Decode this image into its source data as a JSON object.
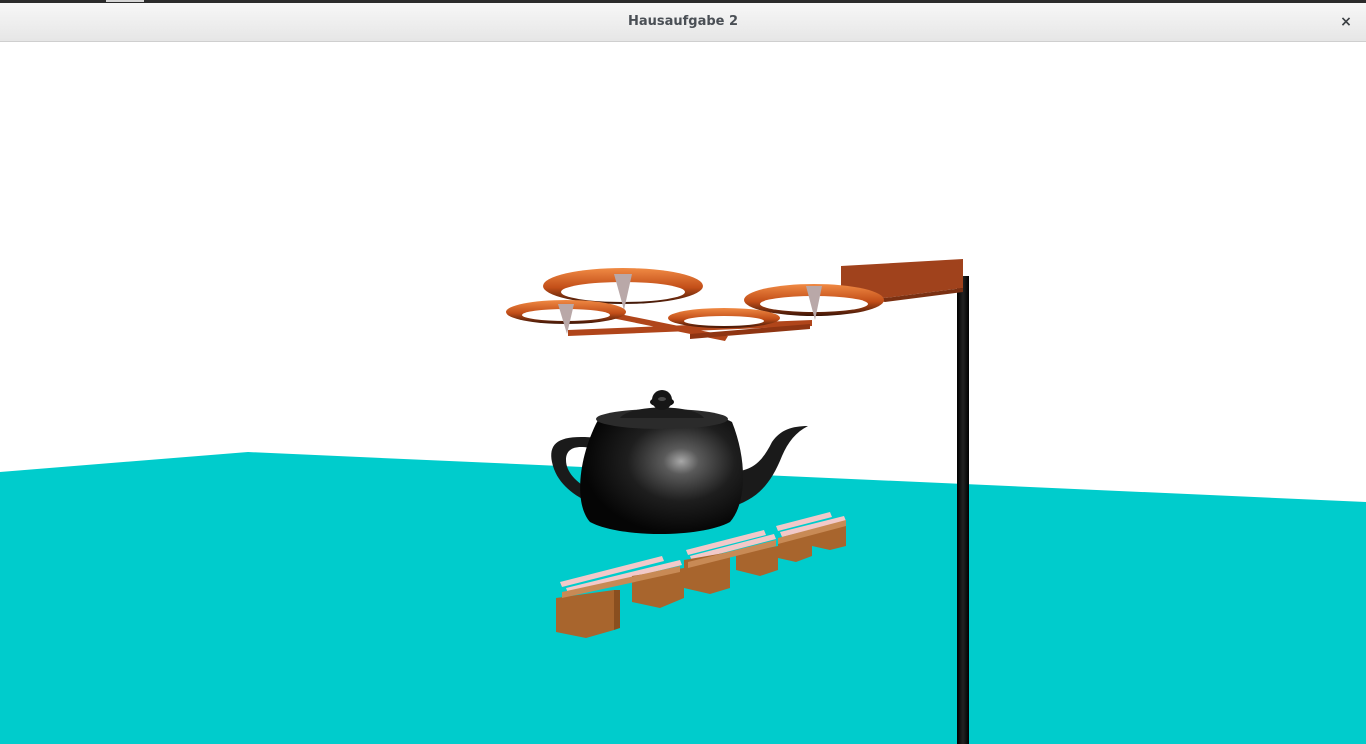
{
  "window": {
    "title": "Hausaufgabe 2",
    "close_glyph": "×"
  },
  "scene": {
    "floor_color": "#00cccc",
    "background_color": "#ffffff",
    "drone_color": "#b0451a",
    "rotor_color": "#e06a2a",
    "teapot_color": "#1a1a1a",
    "pallet_wood_color": "#a8652d",
    "pallet_top_color": "#f2c9c9",
    "lamp_pole_color": "#111111",
    "lamp_head_color": "#a0421c"
  }
}
